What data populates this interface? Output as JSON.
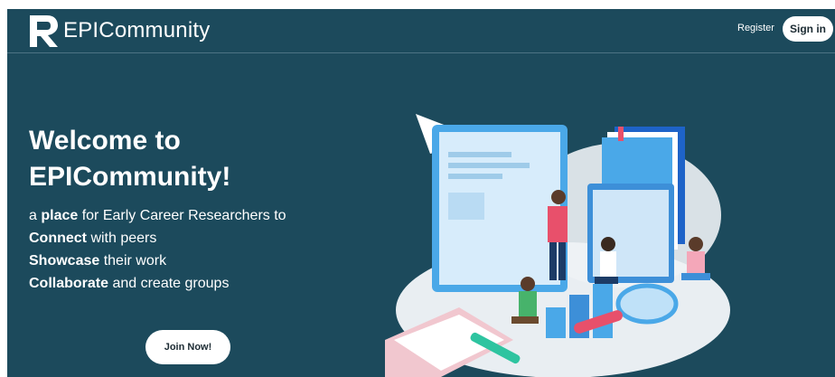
{
  "header": {
    "brand_text": "EPICommunity",
    "register_label": "Register",
    "signin_label": "Sign in"
  },
  "hero": {
    "title_line1": "Welcome to",
    "title_line2": "EPICommunity!",
    "line1_prefix": "a ",
    "line1_bold": "place",
    "line1_suffix": " for Early Career Researchers to",
    "line2_bold": "Connect",
    "line2_suffix": " with peers",
    "line3_bold": "Showcase",
    "line3_suffix": " their work",
    "line4_bold": "Collaborate",
    "line4_suffix": " and create groups",
    "join_label": "Join Now!"
  },
  "colors": {
    "background": "#1c4a5c",
    "button_bg": "#ffffff",
    "text": "#ffffff"
  }
}
